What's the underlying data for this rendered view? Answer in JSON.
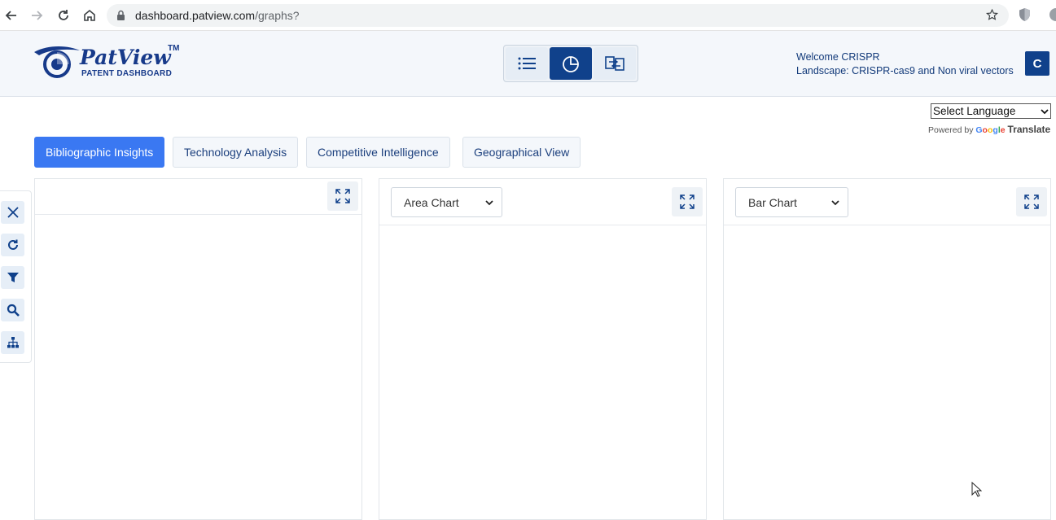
{
  "browser": {
    "url_host": "dashboard.patview.com",
    "url_path": "/graphs?"
  },
  "header": {
    "logo_name": "PatView",
    "logo_tm": "TM",
    "logo_sub": "PATENT DASHBOARD",
    "welcome": "Welcome CRISPR",
    "landscape": "Landscape: CRISPR-cas9 and Non viral vectors",
    "avatar_letter": "C",
    "active_view": "chart-view"
  },
  "language": {
    "select_label": "Select Language",
    "powered_by": "Powered by",
    "google": "Google",
    "translate": "Translate"
  },
  "tabs": [
    {
      "label": "Bibliographic Insights",
      "active": true
    },
    {
      "label": "Technology Analysis",
      "active": false
    },
    {
      "label": "Competitive Intelligence",
      "active": false
    },
    {
      "label": "Geographical View",
      "active": false
    }
  ],
  "side_tools": [
    "close-icon",
    "refresh-icon",
    "filter-icon",
    "search-icon",
    "hierarchy-icon"
  ],
  "panels": [
    {
      "chart_type": ""
    },
    {
      "chart_type": "Area Chart"
    },
    {
      "chart_type": "Bar Chart"
    }
  ],
  "colors": {
    "primary": "#10418b",
    "tab_active": "#3a78f2",
    "header_bg": "#f4f7fb"
  }
}
